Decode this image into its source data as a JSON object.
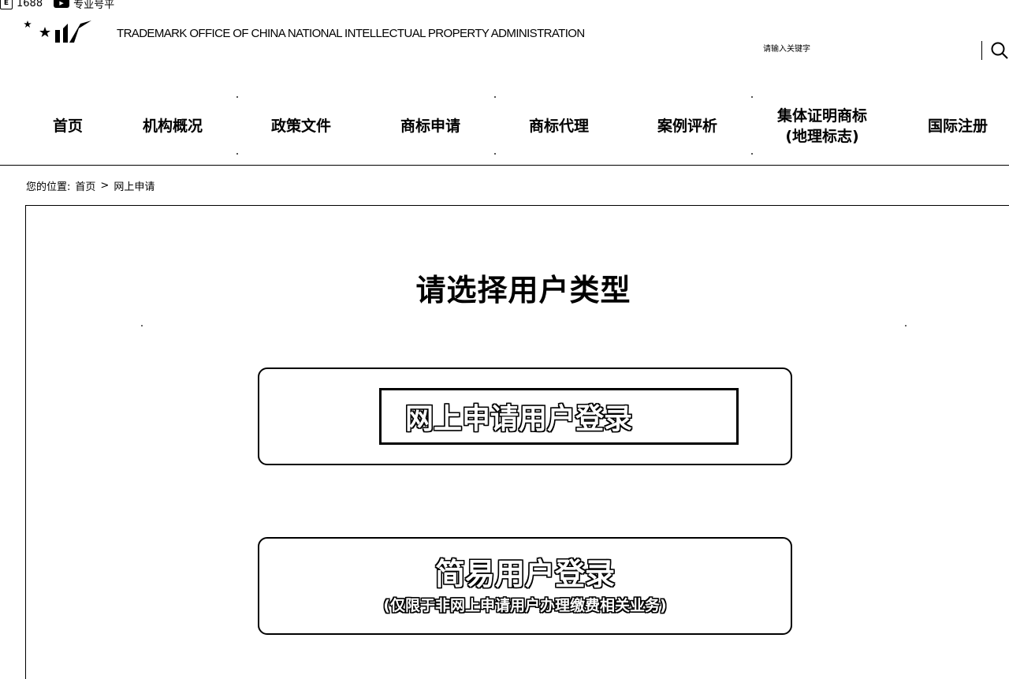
{
  "bookmarks": [
    {
      "label": "1688",
      "icon": "bookmark-app-icon"
    },
    {
      "label": "专业号平",
      "icon": "bookmark-video-icon"
    }
  ],
  "header": {
    "org_name": "TRADEMARK OFFICE OF CHINA NATIONAL INTELLECTUAL PROPERTY ADMINISTRATION",
    "search_placeholder": "请输入关键字",
    "search_icon": "search-icon"
  },
  "nav": {
    "items": [
      {
        "label": "首页"
      },
      {
        "label": "机构概况"
      },
      {
        "label": "政策文件"
      },
      {
        "label": "商标申请"
      },
      {
        "label": "商标代理"
      },
      {
        "label": "案例评析"
      },
      {
        "label": "集体证明商标",
        "label2": "(地理标志)"
      },
      {
        "label": "国际注册"
      }
    ]
  },
  "breadcrumb": {
    "prefix": "您的位置:",
    "home": "首页",
    "separator": ">",
    "current": "网上申请"
  },
  "main": {
    "title": "请选择用户类型",
    "online_login": "网上申请用户登录",
    "simple_login": "简易用户登录",
    "simple_login_note": "(仅限于非网上申请用户办理缴费相关业务)"
  }
}
